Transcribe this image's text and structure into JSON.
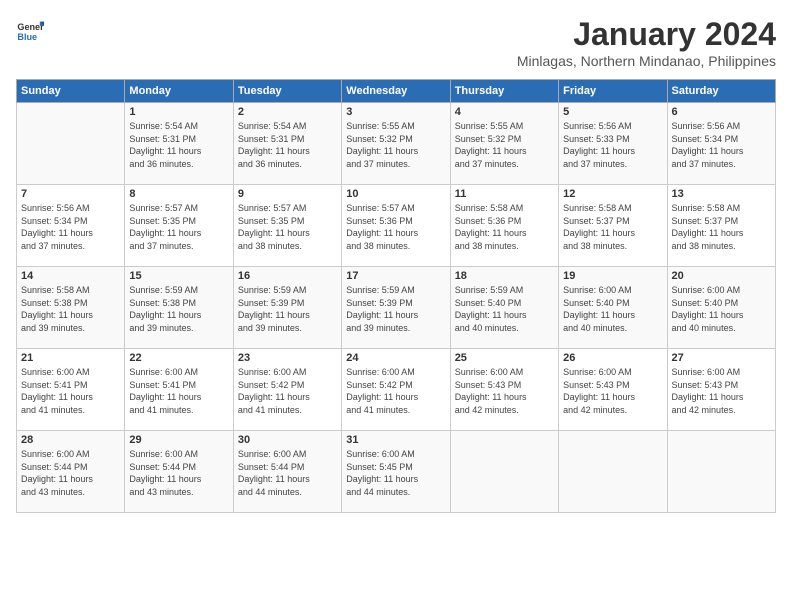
{
  "header": {
    "logo_line1": "General",
    "logo_line2": "Blue",
    "month": "January 2024",
    "location": "Minlagas, Northern Mindanao, Philippines"
  },
  "days_of_week": [
    "Sunday",
    "Monday",
    "Tuesday",
    "Wednesday",
    "Thursday",
    "Friday",
    "Saturday"
  ],
  "weeks": [
    [
      {
        "day": "",
        "content": ""
      },
      {
        "day": "1",
        "content": "Sunrise: 5:54 AM\nSunset: 5:31 PM\nDaylight: 11 hours\nand 36 minutes."
      },
      {
        "day": "2",
        "content": "Sunrise: 5:54 AM\nSunset: 5:31 PM\nDaylight: 11 hours\nand 36 minutes."
      },
      {
        "day": "3",
        "content": "Sunrise: 5:55 AM\nSunset: 5:32 PM\nDaylight: 11 hours\nand 37 minutes."
      },
      {
        "day": "4",
        "content": "Sunrise: 5:55 AM\nSunset: 5:32 PM\nDaylight: 11 hours\nand 37 minutes."
      },
      {
        "day": "5",
        "content": "Sunrise: 5:56 AM\nSunset: 5:33 PM\nDaylight: 11 hours\nand 37 minutes."
      },
      {
        "day": "6",
        "content": "Sunrise: 5:56 AM\nSunset: 5:34 PM\nDaylight: 11 hours\nand 37 minutes."
      }
    ],
    [
      {
        "day": "7",
        "content": "Sunrise: 5:56 AM\nSunset: 5:34 PM\nDaylight: 11 hours\nand 37 minutes."
      },
      {
        "day": "8",
        "content": "Sunrise: 5:57 AM\nSunset: 5:35 PM\nDaylight: 11 hours\nand 37 minutes."
      },
      {
        "day": "9",
        "content": "Sunrise: 5:57 AM\nSunset: 5:35 PM\nDaylight: 11 hours\nand 38 minutes."
      },
      {
        "day": "10",
        "content": "Sunrise: 5:57 AM\nSunset: 5:36 PM\nDaylight: 11 hours\nand 38 minutes."
      },
      {
        "day": "11",
        "content": "Sunrise: 5:58 AM\nSunset: 5:36 PM\nDaylight: 11 hours\nand 38 minutes."
      },
      {
        "day": "12",
        "content": "Sunrise: 5:58 AM\nSunset: 5:37 PM\nDaylight: 11 hours\nand 38 minutes."
      },
      {
        "day": "13",
        "content": "Sunrise: 5:58 AM\nSunset: 5:37 PM\nDaylight: 11 hours\nand 38 minutes."
      }
    ],
    [
      {
        "day": "14",
        "content": "Sunrise: 5:58 AM\nSunset: 5:38 PM\nDaylight: 11 hours\nand 39 minutes."
      },
      {
        "day": "15",
        "content": "Sunrise: 5:59 AM\nSunset: 5:38 PM\nDaylight: 11 hours\nand 39 minutes."
      },
      {
        "day": "16",
        "content": "Sunrise: 5:59 AM\nSunset: 5:39 PM\nDaylight: 11 hours\nand 39 minutes."
      },
      {
        "day": "17",
        "content": "Sunrise: 5:59 AM\nSunset: 5:39 PM\nDaylight: 11 hours\nand 39 minutes."
      },
      {
        "day": "18",
        "content": "Sunrise: 5:59 AM\nSunset: 5:40 PM\nDaylight: 11 hours\nand 40 minutes."
      },
      {
        "day": "19",
        "content": "Sunrise: 6:00 AM\nSunset: 5:40 PM\nDaylight: 11 hours\nand 40 minutes."
      },
      {
        "day": "20",
        "content": "Sunrise: 6:00 AM\nSunset: 5:40 PM\nDaylight: 11 hours\nand 40 minutes."
      }
    ],
    [
      {
        "day": "21",
        "content": "Sunrise: 6:00 AM\nSunset: 5:41 PM\nDaylight: 11 hours\nand 41 minutes."
      },
      {
        "day": "22",
        "content": "Sunrise: 6:00 AM\nSunset: 5:41 PM\nDaylight: 11 hours\nand 41 minutes."
      },
      {
        "day": "23",
        "content": "Sunrise: 6:00 AM\nSunset: 5:42 PM\nDaylight: 11 hours\nand 41 minutes."
      },
      {
        "day": "24",
        "content": "Sunrise: 6:00 AM\nSunset: 5:42 PM\nDaylight: 11 hours\nand 41 minutes."
      },
      {
        "day": "25",
        "content": "Sunrise: 6:00 AM\nSunset: 5:43 PM\nDaylight: 11 hours\nand 42 minutes."
      },
      {
        "day": "26",
        "content": "Sunrise: 6:00 AM\nSunset: 5:43 PM\nDaylight: 11 hours\nand 42 minutes."
      },
      {
        "day": "27",
        "content": "Sunrise: 6:00 AM\nSunset: 5:43 PM\nDaylight: 11 hours\nand 42 minutes."
      }
    ],
    [
      {
        "day": "28",
        "content": "Sunrise: 6:00 AM\nSunset: 5:44 PM\nDaylight: 11 hours\nand 43 minutes."
      },
      {
        "day": "29",
        "content": "Sunrise: 6:00 AM\nSunset: 5:44 PM\nDaylight: 11 hours\nand 43 minutes."
      },
      {
        "day": "30",
        "content": "Sunrise: 6:00 AM\nSunset: 5:44 PM\nDaylight: 11 hours\nand 44 minutes."
      },
      {
        "day": "31",
        "content": "Sunrise: 6:00 AM\nSunset: 5:45 PM\nDaylight: 11 hours\nand 44 minutes."
      },
      {
        "day": "",
        "content": ""
      },
      {
        "day": "",
        "content": ""
      },
      {
        "day": "",
        "content": ""
      }
    ]
  ]
}
